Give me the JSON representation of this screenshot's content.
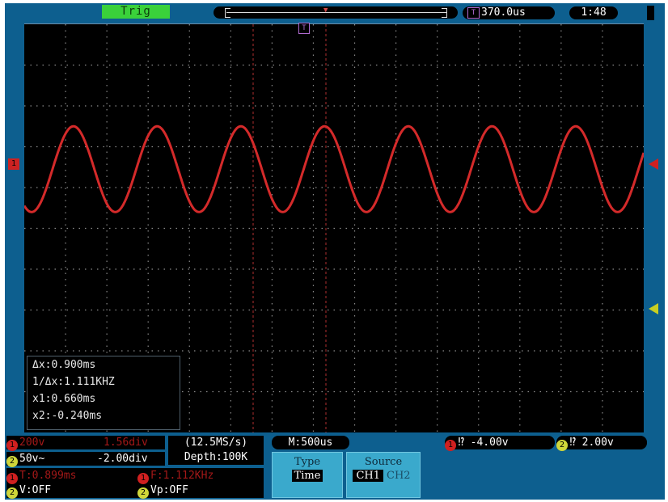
{
  "colors": {
    "bezel": "#0d5f8f",
    "trace": "#d42a2a",
    "grid": "#8a8a8a",
    "ch1": "#d02020",
    "ch2": "#cfd63a",
    "trig": "#3ad13a",
    "menu": "#3aa9cc"
  },
  "status": {
    "trig_label": "Trig",
    "trigger_icon": "T",
    "horizontal_delay": "370.0us",
    "clock": "1:48"
  },
  "markers": {
    "trigger_pos": "T",
    "ch1_ref": "1"
  },
  "measurement": {
    "delta_x": "Δx:0.900ms",
    "inv_delta_x": "1/Δx:1.111KHZ",
    "x1": "x1:0.660ms",
    "x2": "x2:-0.240ms"
  },
  "ch1": {
    "badge": "1",
    "volts": "200v",
    "offset": "1.56div"
  },
  "ch2": {
    "badge": "2",
    "volts": "50v~",
    "offset": "-2.00div"
  },
  "acquisition": {
    "sample_rate": "(12.5MS/s)",
    "depth": "Depth:100K",
    "timebase": "M:500us"
  },
  "trigger_levels": {
    "ch1_level": "-4.00v",
    "ch2_level": "2.00v",
    "ch1_badge": "1",
    "ch2_badge": "2",
    "edge_icon": "rising-edge-icon"
  },
  "readouts": {
    "ch1_period": "T:0.899ms",
    "ch1_freq": "F:1.112KHz",
    "ch2_v": "V:OFF",
    "ch2_vp": "Vp:OFF"
  },
  "menu": {
    "type_label": "Type",
    "type_value": "Time",
    "source_label": "Source",
    "source_options": [
      "CH1",
      "CH2"
    ],
    "source_selected": "CH1"
  },
  "waveform": {
    "shape": "sine",
    "cycles_on_screen": 7.4,
    "amplitude_div": 1.05,
    "center_div_from_top": 3.55
  }
}
